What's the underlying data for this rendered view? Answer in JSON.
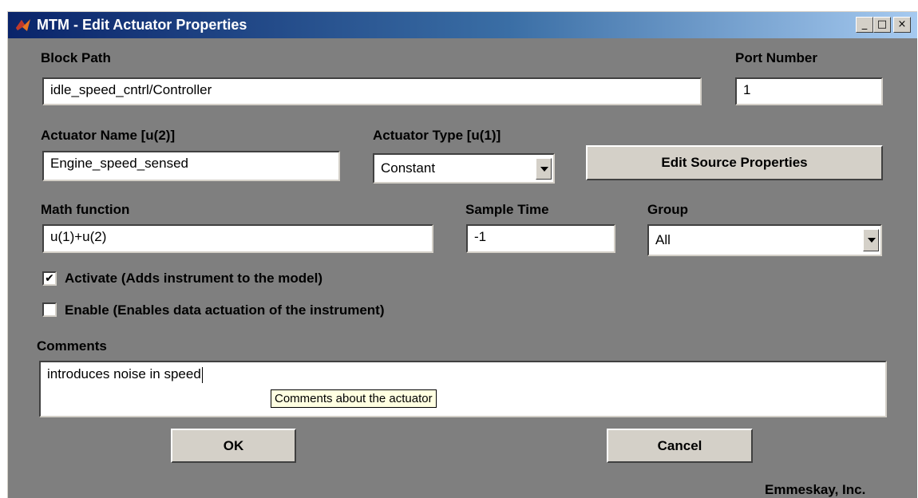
{
  "window": {
    "title": "MTM - Edit Actuator Properties",
    "controls": {
      "minimize": "_",
      "maximize": "□",
      "close": "×"
    }
  },
  "form": {
    "block_path": {
      "label": "Block Path",
      "value": "idle_speed_cntrl/Controller"
    },
    "port_number": {
      "label": "Port Number",
      "value": "1"
    },
    "actuator_name": {
      "label": "Actuator Name [u(2)]",
      "value": "Engine_speed_sensed"
    },
    "actuator_type": {
      "label": "Actuator Type [u(1)]",
      "selected": "Constant"
    },
    "edit_source_button": "Edit Source Properties",
    "math_function": {
      "label": "Math function",
      "value": "u(1)+u(2)"
    },
    "sample_time": {
      "label": "Sample Time",
      "value": "-1"
    },
    "group": {
      "label": "Group",
      "selected": "All"
    },
    "activate": {
      "label": "Activate (Adds instrument to the model)",
      "checked": true,
      "mark": "✔"
    },
    "enable": {
      "label": "Enable (Enables data actuation of the instrument)",
      "checked": false
    },
    "comments": {
      "label": "Comments",
      "value": "introduces noise in speed",
      "tooltip": "Comments about the actuator"
    }
  },
  "buttons": {
    "ok": "OK",
    "cancel": "Cancel"
  },
  "footer": {
    "company": "Emmeskay, Inc."
  }
}
